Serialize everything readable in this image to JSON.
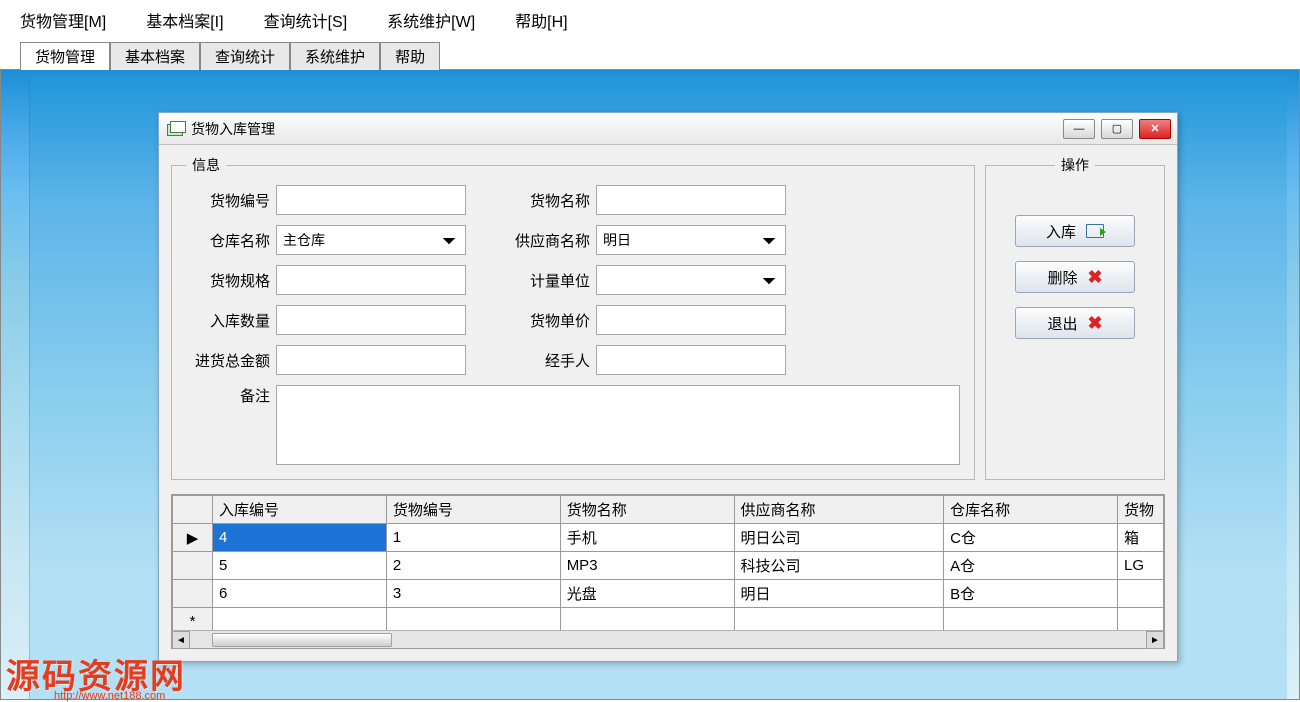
{
  "menubar": [
    "货物管理[M]",
    "基本档案[I]",
    "查询统计[S]",
    "系统维护[W]",
    "帮助[H]"
  ],
  "tabs": [
    "货物管理",
    "基本档案",
    "查询统计",
    "系统维护",
    "帮助"
  ],
  "dialog": {
    "title": "货物入库管理",
    "groups": {
      "info": "信息",
      "ops": "操作"
    },
    "labels": {
      "goods_no": "货物编号",
      "goods_name": "货物名称",
      "warehouse": "仓库名称",
      "supplier": "供应商名称",
      "spec": "货物规格",
      "unit": "计量单位",
      "qty": "入库数量",
      "price": "货物单价",
      "total": "进货总金额",
      "handler": "经手人",
      "remark": "备注"
    },
    "values": {
      "goods_no": "",
      "goods_name": "",
      "warehouse": "主仓库",
      "supplier": "明日",
      "spec": "",
      "unit": "",
      "qty": "",
      "price": "",
      "total": "",
      "handler": "",
      "remark": ""
    },
    "buttons": {
      "in": "入库",
      "del": "删除",
      "exit": "退出"
    }
  },
  "grid": {
    "headers": [
      "入库编号",
      "货物编号",
      "货物名称",
      "供应商名称",
      "仓库名称",
      "货物"
    ],
    "rows": [
      {
        "marker": "▶",
        "selected": true,
        "cells": [
          "4",
          "1",
          "手机",
          "明日公司",
          "C仓",
          "箱"
        ]
      },
      {
        "marker": "",
        "selected": false,
        "cells": [
          "5",
          "2",
          "MP3",
          "科技公司",
          "A仓",
          "LG"
        ]
      },
      {
        "marker": "",
        "selected": false,
        "cells": [
          "6",
          "3",
          "光盘",
          "明日",
          "B仓",
          ""
        ]
      },
      {
        "marker": "*",
        "selected": false,
        "cells": [
          "",
          "",
          "",
          "",
          "",
          ""
        ]
      }
    ]
  },
  "watermark": {
    "main": "源码资源网",
    "sub": "http://www.net188.com"
  }
}
